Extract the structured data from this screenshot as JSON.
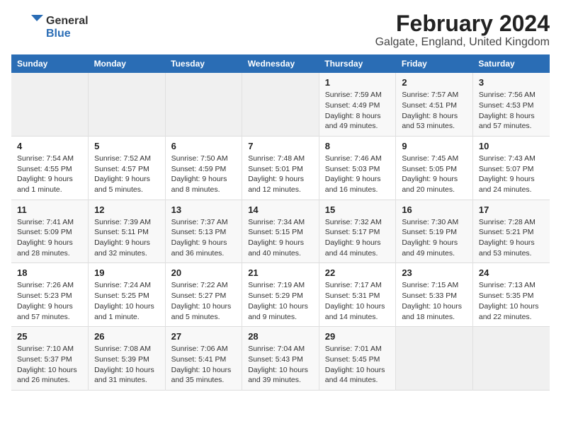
{
  "logo": {
    "text_general": "General",
    "text_blue": "Blue"
  },
  "title": "February 2024",
  "subtitle": "Galgate, England, United Kingdom",
  "headers": [
    "Sunday",
    "Monday",
    "Tuesday",
    "Wednesday",
    "Thursday",
    "Friday",
    "Saturday"
  ],
  "weeks": [
    [
      {
        "day": "",
        "empty": true
      },
      {
        "day": "",
        "empty": true
      },
      {
        "day": "",
        "empty": true
      },
      {
        "day": "",
        "empty": true
      },
      {
        "day": "1",
        "sunrise": "7:59 AM",
        "sunset": "4:49 PM",
        "daylight": "8 hours and 49 minutes."
      },
      {
        "day": "2",
        "sunrise": "7:57 AM",
        "sunset": "4:51 PM",
        "daylight": "8 hours and 53 minutes."
      },
      {
        "day": "3",
        "sunrise": "7:56 AM",
        "sunset": "4:53 PM",
        "daylight": "8 hours and 57 minutes."
      }
    ],
    [
      {
        "day": "4",
        "sunrise": "7:54 AM",
        "sunset": "4:55 PM",
        "daylight": "9 hours and 1 minute."
      },
      {
        "day": "5",
        "sunrise": "7:52 AM",
        "sunset": "4:57 PM",
        "daylight": "9 hours and 5 minutes."
      },
      {
        "day": "6",
        "sunrise": "7:50 AM",
        "sunset": "4:59 PM",
        "daylight": "9 hours and 8 minutes."
      },
      {
        "day": "7",
        "sunrise": "7:48 AM",
        "sunset": "5:01 PM",
        "daylight": "9 hours and 12 minutes."
      },
      {
        "day": "8",
        "sunrise": "7:46 AM",
        "sunset": "5:03 PM",
        "daylight": "9 hours and 16 minutes."
      },
      {
        "day": "9",
        "sunrise": "7:45 AM",
        "sunset": "5:05 PM",
        "daylight": "9 hours and 20 minutes."
      },
      {
        "day": "10",
        "sunrise": "7:43 AM",
        "sunset": "5:07 PM",
        "daylight": "9 hours and 24 minutes."
      }
    ],
    [
      {
        "day": "11",
        "sunrise": "7:41 AM",
        "sunset": "5:09 PM",
        "daylight": "9 hours and 28 minutes."
      },
      {
        "day": "12",
        "sunrise": "7:39 AM",
        "sunset": "5:11 PM",
        "daylight": "9 hours and 32 minutes."
      },
      {
        "day": "13",
        "sunrise": "7:37 AM",
        "sunset": "5:13 PM",
        "daylight": "9 hours and 36 minutes."
      },
      {
        "day": "14",
        "sunrise": "7:34 AM",
        "sunset": "5:15 PM",
        "daylight": "9 hours and 40 minutes."
      },
      {
        "day": "15",
        "sunrise": "7:32 AM",
        "sunset": "5:17 PM",
        "daylight": "9 hours and 44 minutes."
      },
      {
        "day": "16",
        "sunrise": "7:30 AM",
        "sunset": "5:19 PM",
        "daylight": "9 hours and 49 minutes."
      },
      {
        "day": "17",
        "sunrise": "7:28 AM",
        "sunset": "5:21 PM",
        "daylight": "9 hours and 53 minutes."
      }
    ],
    [
      {
        "day": "18",
        "sunrise": "7:26 AM",
        "sunset": "5:23 PM",
        "daylight": "9 hours and 57 minutes."
      },
      {
        "day": "19",
        "sunrise": "7:24 AM",
        "sunset": "5:25 PM",
        "daylight": "10 hours and 1 minute."
      },
      {
        "day": "20",
        "sunrise": "7:22 AM",
        "sunset": "5:27 PM",
        "daylight": "10 hours and 5 minutes."
      },
      {
        "day": "21",
        "sunrise": "7:19 AM",
        "sunset": "5:29 PM",
        "daylight": "10 hours and 9 minutes."
      },
      {
        "day": "22",
        "sunrise": "7:17 AM",
        "sunset": "5:31 PM",
        "daylight": "10 hours and 14 minutes."
      },
      {
        "day": "23",
        "sunrise": "7:15 AM",
        "sunset": "5:33 PM",
        "daylight": "10 hours and 18 minutes."
      },
      {
        "day": "24",
        "sunrise": "7:13 AM",
        "sunset": "5:35 PM",
        "daylight": "10 hours and 22 minutes."
      }
    ],
    [
      {
        "day": "25",
        "sunrise": "7:10 AM",
        "sunset": "5:37 PM",
        "daylight": "10 hours and 26 minutes."
      },
      {
        "day": "26",
        "sunrise": "7:08 AM",
        "sunset": "5:39 PM",
        "daylight": "10 hours and 31 minutes."
      },
      {
        "day": "27",
        "sunrise": "7:06 AM",
        "sunset": "5:41 PM",
        "daylight": "10 hours and 35 minutes."
      },
      {
        "day": "28",
        "sunrise": "7:04 AM",
        "sunset": "5:43 PM",
        "daylight": "10 hours and 39 minutes."
      },
      {
        "day": "29",
        "sunrise": "7:01 AM",
        "sunset": "5:45 PM",
        "daylight": "10 hours and 44 minutes."
      },
      {
        "day": "",
        "empty": true
      },
      {
        "day": "",
        "empty": true
      }
    ]
  ]
}
